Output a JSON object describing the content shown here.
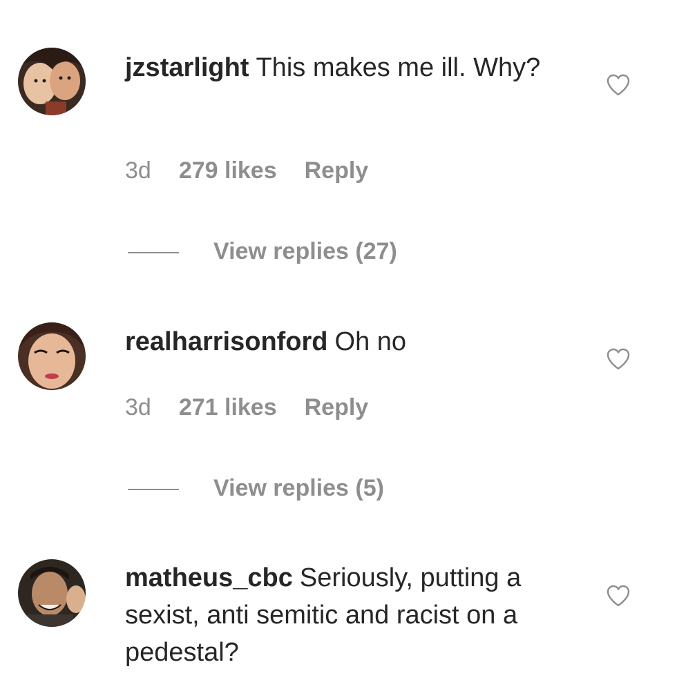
{
  "comments": [
    {
      "username": "jzstarlight",
      "text": "This makes me ill. Why?",
      "time": "3d",
      "likes": "279 likes",
      "reply": "Reply",
      "view_replies": "View replies (27)"
    },
    {
      "username": "realharrisonford",
      "text": "Oh no",
      "time": "3d",
      "likes": "271 likes",
      "reply": "Reply",
      "view_replies": "View replies (5)"
    },
    {
      "username": "matheus_cbc",
      "text": "Seriously, putting a sexist, anti semitic and racist on a pedestal?"
    }
  ],
  "icons": {
    "like": "heart-outline-icon"
  },
  "colors": {
    "text": "#262626",
    "secondary": "#8e8e8e",
    "icon": "#8e8e8e"
  }
}
